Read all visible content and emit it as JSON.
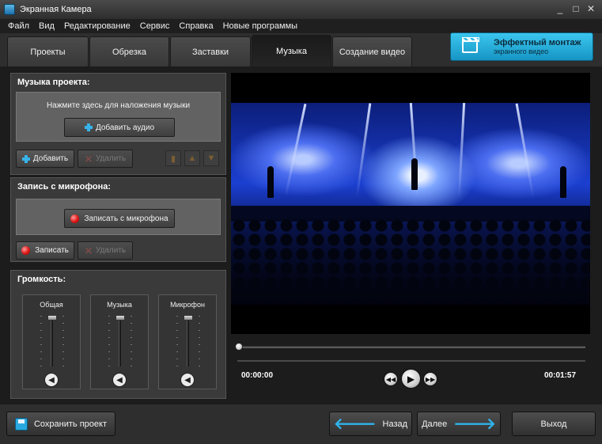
{
  "window": {
    "title": "Экранная Камера",
    "minimize": "_",
    "maximize": "□",
    "close": "✕"
  },
  "menu": [
    "Файл",
    "Вид",
    "Редактирование",
    "Сервис",
    "Справка",
    "Новые программы"
  ],
  "tabs": [
    {
      "label": "Проекты",
      "active": false
    },
    {
      "label": "Обрезка",
      "active": false
    },
    {
      "label": "Заставки",
      "active": false
    },
    {
      "label": "Музыка",
      "active": true
    },
    {
      "label": "Создание видео",
      "active": false
    }
  ],
  "promo": {
    "title": "Эффектный монтаж",
    "subtitle": "экранного видео"
  },
  "music_panel": {
    "heading": "Музыка проекта:",
    "hint": "Нажмите здесь для наложения музыки",
    "add_audio": "Добавить аудио",
    "add": "Добавить",
    "delete": "Удалить"
  },
  "mic_panel": {
    "heading": "Запись с микрофона:",
    "record_mic": "Записать с микрофона",
    "record": "Записать",
    "delete": "Удалить"
  },
  "volume_panel": {
    "heading": "Громкость:",
    "channels": [
      {
        "label": "Общая",
        "level": 1.0
      },
      {
        "label": "Музыка",
        "level": 1.0
      },
      {
        "label": "Микрофон",
        "level": 1.0
      }
    ]
  },
  "player": {
    "current_time": "00:00:00",
    "total_time": "00:01:57",
    "progress": 0.0
  },
  "footer": {
    "save": "Сохранить проект",
    "back": "Назад",
    "next": "Далее",
    "exit": "Выход"
  }
}
